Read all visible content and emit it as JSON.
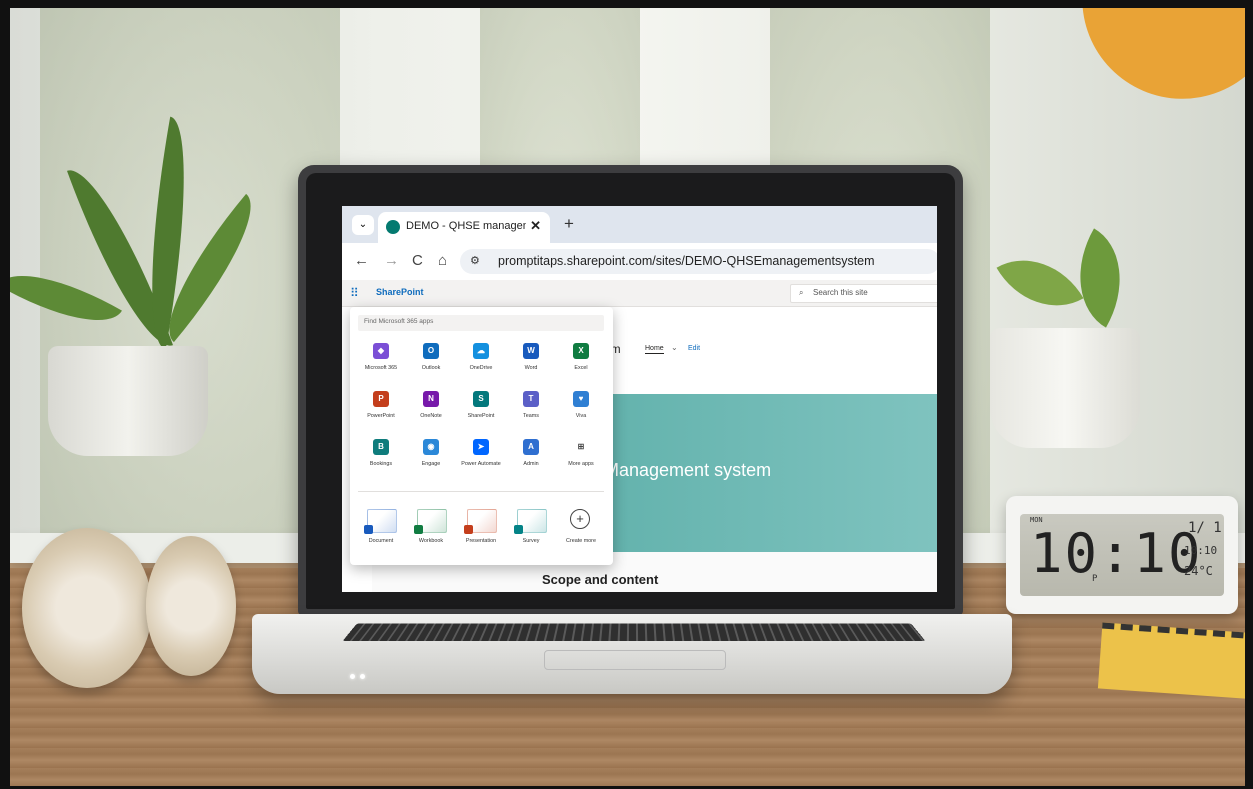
{
  "browser": {
    "tab_dropdown_icon": "chevron-down-icon",
    "tab_title": "DEMO - QHSE management sy",
    "tab_close": "✕",
    "new_tab": "+",
    "nav": {
      "back": "←",
      "forward": "→",
      "reload": "C",
      "home": "⌂"
    },
    "url": "promptitaps.sharepoint.com/sites/DEMO-QHSEmanagementsystem"
  },
  "sharepoint": {
    "brand": "SharePoint",
    "search_placeholder": "Search this site",
    "site_title_fragment": "em",
    "nav_home": "Home",
    "nav_edit": "Edit",
    "hero_title": "Management system",
    "section_heading": "Scope and content"
  },
  "launcher": {
    "search_placeholder": "Find Microsoft 365 apps",
    "apps": [
      {
        "label": "Microsoft 365",
        "icon": "microsoft365-icon",
        "color": "#7b4fd6"
      },
      {
        "label": "Outlook",
        "icon": "outlook-icon",
        "color": "#0f6cbd"
      },
      {
        "label": "OneDrive",
        "icon": "onedrive-icon",
        "color": "#1490df"
      },
      {
        "label": "Word",
        "icon": "word-icon",
        "color": "#185abd"
      },
      {
        "label": "Excel",
        "icon": "excel-icon",
        "color": "#107c41"
      },
      {
        "label": "PowerPoint",
        "icon": "powerpoint-icon",
        "color": "#c43e1c"
      },
      {
        "label": "OneNote",
        "icon": "onenote-icon",
        "color": "#7719aa"
      },
      {
        "label": "SharePoint",
        "icon": "sharepoint-icon",
        "color": "#03787c"
      },
      {
        "label": "Teams",
        "icon": "teams-icon",
        "color": "#5b5fc7"
      },
      {
        "label": "Viva",
        "icon": "viva-icon",
        "color": "#2f7fd3"
      },
      {
        "label": "Bookings",
        "icon": "bookings-icon",
        "color": "#0f7c7c"
      },
      {
        "label": "Engage",
        "icon": "engage-icon",
        "color": "#2b88d8"
      },
      {
        "label": "Power Automate",
        "icon": "power-automate-icon",
        "color": "#0066ff"
      },
      {
        "label": "Admin",
        "icon": "admin-icon",
        "color": "#2f6fd0"
      },
      {
        "label": "More apps",
        "icon": "more-apps-icon",
        "color": "#444444"
      }
    ],
    "create": [
      {
        "label": "Document",
        "icon": "document-icon",
        "color": "#185abd"
      },
      {
        "label": "Workbook",
        "icon": "workbook-icon",
        "color": "#107c41"
      },
      {
        "label": "Presentation",
        "icon": "presentation-icon",
        "color": "#c43e1c"
      },
      {
        "label": "Survey",
        "icon": "survey-icon",
        "color": "#038387"
      },
      {
        "label": "Create more",
        "icon": "add-circle-icon",
        "color": "#444444"
      }
    ]
  },
  "clock": {
    "time": "10:10",
    "day": "MON",
    "date": "1/ 1",
    "alarm": "10:10",
    "temp": "24°C",
    "meridiem": "P"
  }
}
